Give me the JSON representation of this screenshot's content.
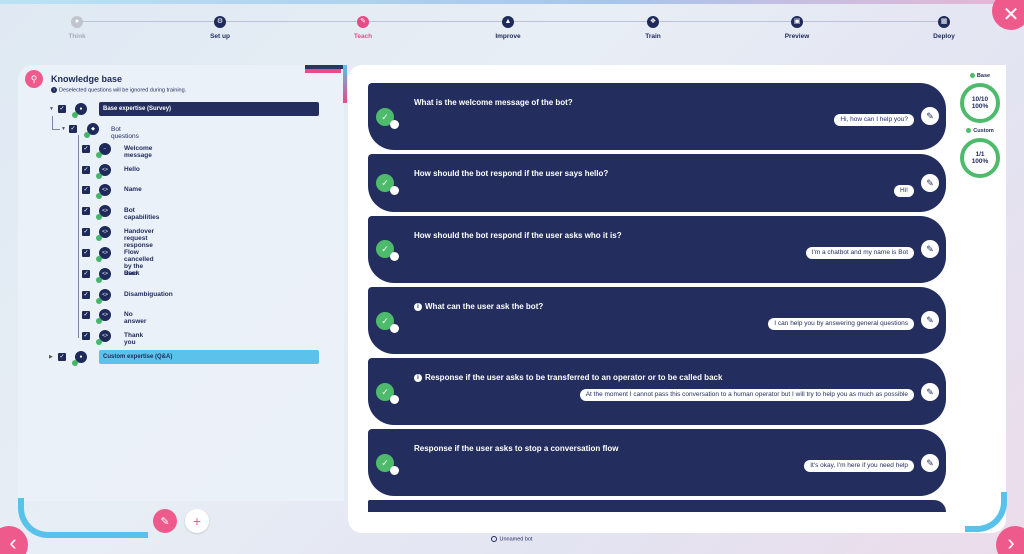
{
  "steps": [
    {
      "label": "Think",
      "state": "done",
      "icon": "lightbulb-icon"
    },
    {
      "label": "Set up",
      "state": "normal",
      "icon": "gear-icon"
    },
    {
      "label": "Teach",
      "state": "active",
      "icon": "pencil-icon"
    },
    {
      "label": "Improve",
      "state": "normal",
      "icon": "chart-icon"
    },
    {
      "label": "Train",
      "state": "normal",
      "icon": "brain-icon"
    },
    {
      "label": "Preview",
      "state": "normal",
      "icon": "preview-icon"
    },
    {
      "label": "Deploy",
      "state": "normal",
      "icon": "deploy-icon"
    }
  ],
  "knowledge": {
    "title": "Knowledge base",
    "subtitle": "Deselected questions will be ignored during training.",
    "groups": [
      {
        "label": "Base expertise (Survey)"
      },
      {
        "label": "Custom expertise (Q&A)"
      }
    ],
    "subgroup": "Bot questions",
    "items": [
      "Welcome message",
      "Hello",
      "Name",
      "Bot capabilities",
      "Handover request response",
      "Flow cancelled by the user",
      "Back",
      "Disambiguation",
      "No answer",
      "Thank you"
    ]
  },
  "cards": [
    {
      "question": "What is the welcome message of the bot?",
      "answer": "Hi, how can I help you?",
      "info": false
    },
    {
      "question": "How should the bot respond if the user says hello?",
      "answer": "Hi!",
      "info": false
    },
    {
      "question": "How should the bot respond if the user asks who it is?",
      "answer": "I'm a chatbot and my name is Bot",
      "info": false
    },
    {
      "question": "What can the user ask the bot?",
      "answer": "I can help you by answering general questions",
      "info": true
    },
    {
      "question": "Response if the user asks to be transferred to an operator or to be called back",
      "answer": "At the moment I cannot pass this conversation to a human operator but I will try to help you as much as possible",
      "info": true
    },
    {
      "question": "Response if the user asks to stop a conversation flow",
      "answer": "It's okay, I'm here if you need help",
      "info": false
    }
  ],
  "stats": [
    {
      "label": "Base",
      "count": "10/10",
      "percent": "100%"
    },
    {
      "label": "Custom",
      "count": "1/1",
      "percent": "100%"
    }
  ],
  "footer": {
    "bot_name": "Unnamed bot"
  },
  "colors": {
    "accent": "#ef5a8c",
    "navy": "#232e5f",
    "green": "#4dbb6b",
    "sky": "#5bc3eb"
  }
}
